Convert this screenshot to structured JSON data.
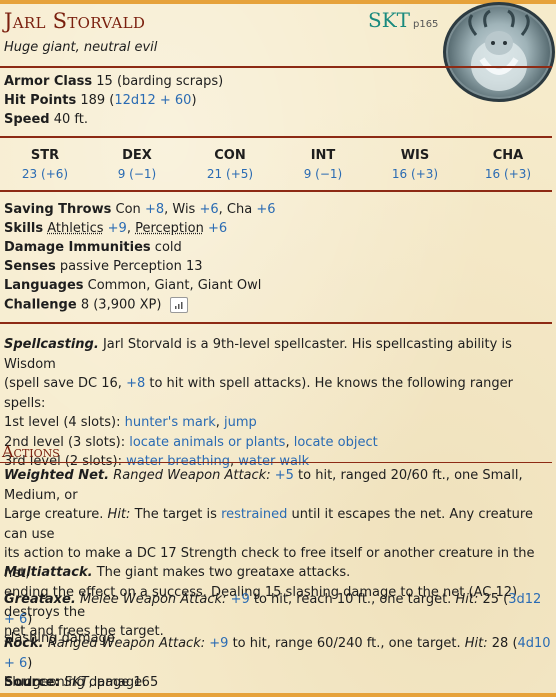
{
  "header": {
    "name": "Jarl Storvald",
    "source_abbr": "SKT",
    "source_page": "p165",
    "subtitle": "Huge giant, neutral evil",
    "token_icon": "frost-giant-portrait"
  },
  "stats": {
    "ac_label": "Armor Class",
    "ac_value": "15 (barding scraps)",
    "hp_label": "Hit Points",
    "hp_value": "189",
    "hp_roll": "12d12 + 60",
    "speed_label": "Speed",
    "speed_value": "40 ft."
  },
  "abilities": [
    {
      "name": "STR",
      "value": "23 (+6)"
    },
    {
      "name": "DEX",
      "value": "9 (−1)"
    },
    {
      "name": "CON",
      "value": "21 (+5)"
    },
    {
      "name": "INT",
      "value": "9 (−1)"
    },
    {
      "name": "WIS",
      "value": "16 (+3)"
    },
    {
      "name": "CHA",
      "value": "16 (+3)"
    }
  ],
  "props": {
    "saves_label": "Saving Throws",
    "saves": [
      {
        "name": "Con",
        "bonus": "+8"
      },
      {
        "name": "Wis",
        "bonus": "+6"
      },
      {
        "name": "Cha",
        "bonus": "+6"
      }
    ],
    "skills_label": "Skills",
    "skills": [
      {
        "name": "Athletics",
        "bonus": "+9"
      },
      {
        "name": "Perception",
        "bonus": "+6"
      }
    ],
    "immunities_label": "Damage Immunities",
    "immunities_value": "cold",
    "senses_label": "Senses",
    "senses_value": "passive Perception 13",
    "languages_label": "Languages",
    "languages_value": "Common, Giant, Giant Owl",
    "challenge_label": "Challenge",
    "challenge_value": "8 (3,900 XP)",
    "challenge_icon": "bar-chart-icon"
  },
  "spellcasting": {
    "title": "Spellcasting.",
    "text1": "Jarl Storvald is a 9th-level spellcaster. His spellcasting ability is Wisdom",
    "text2a": "(spell save DC 16,",
    "text2_bonus": "+8",
    "text2b": "to hit with spell attacks). He knows the following ranger spells:",
    "levels": [
      {
        "label": "1st level (4 slots):",
        "spells": [
          "hunter's mark",
          "jump"
        ]
      },
      {
        "label": "2nd level (3 slots):",
        "spells": [
          "locate animals or plants",
          "locate object"
        ]
      },
      {
        "label": "3rd level (2 slots):",
        "spells": [
          "water breathing",
          "water walk"
        ]
      }
    ]
  },
  "actions_heading": "Actions",
  "actions": {
    "net_title": "Weighted Net.",
    "net_type": "Ranged Weapon Attack:",
    "net_bonus": "+5",
    "net_l1": "to hit, ranged 20/60 ft., one Small, Medium, or",
    "net_l2a": "Large creature.",
    "net_hit": "Hit:",
    "net_l2b": "The target is",
    "net_restrained": "restrained",
    "net_l2c": "until it escapes the net. Any creature can use",
    "net_l3": "its action to make a DC 17 Strength check to free itself or another creature in the net,",
    "net_l4": "ending the effect on a success. Dealing 15 slashing damage to the net (AC 12) destroys the",
    "net_l5": "net and frees the target.",
    "multi_title": "Multiattack.",
    "multi_text": "The giant makes two greataxe attacks.",
    "axe_title": "Greataxe.",
    "axe_type": "Melee Weapon Attack:",
    "axe_bonus": "+9",
    "axe_text": "to hit, reach 10 ft., one target.",
    "axe_hit": "Hit:",
    "axe_dmg": "25 (",
    "axe_roll": "3d12 + 6",
    "axe_close": ")",
    "axe_l2": "slashing damage.",
    "rock_title": "Rock.",
    "rock_type": "Ranged Weapon Attack:",
    "rock_bonus": "+9",
    "rock_text": "to hit, range 60/240 ft., one target.",
    "rock_hit": "Hit:",
    "rock_dmg": "28 (",
    "rock_roll": "4d10 + 6",
    "rock_close": ")",
    "rock_l2": "bludgeoning damage."
  },
  "source": {
    "label": "Source:",
    "book": "SKT",
    "page": ", page 165"
  },
  "colors": {
    "accent": "#7a1f0e",
    "link": "#2a6bb3",
    "bar": "#e6a23b",
    "teal": "#1a8a7e"
  }
}
